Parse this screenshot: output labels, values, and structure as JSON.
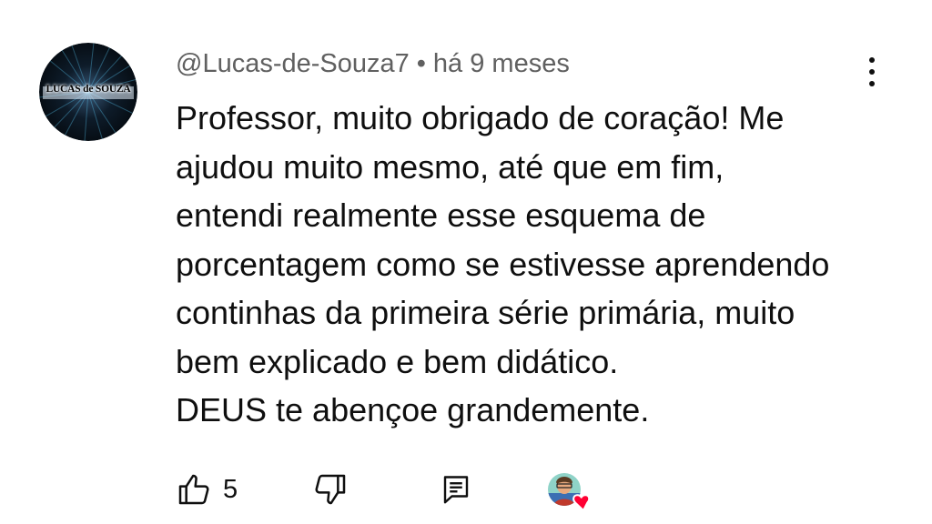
{
  "comment": {
    "avatar_text": "LUCAS de SOUZA",
    "author": "@Lucas-de-Souza7",
    "separator": "•",
    "time": "há 9 meses",
    "lines": [
      "Professor, muito obrigado de coração! Me",
      "ajudou muito mesmo, até que em fim,",
      "entendi realmente esse esquema de",
      "porcentagem como se estivesse aprendendo",
      "continhas da primeira série primária, muito",
      "bem explicado e bem didático.",
      "DEUS te abençoe grandemente."
    ],
    "like_count": "5"
  },
  "icons": {
    "more": "more-vert-icon",
    "like": "thumb-up-icon",
    "dislike": "thumb-down-icon",
    "reply": "comment-reply-icon",
    "creator_heart": "creator-heart-icon"
  },
  "colors": {
    "text": "#0f0f0f",
    "meta": "#606060",
    "heart": "#ff0033"
  }
}
